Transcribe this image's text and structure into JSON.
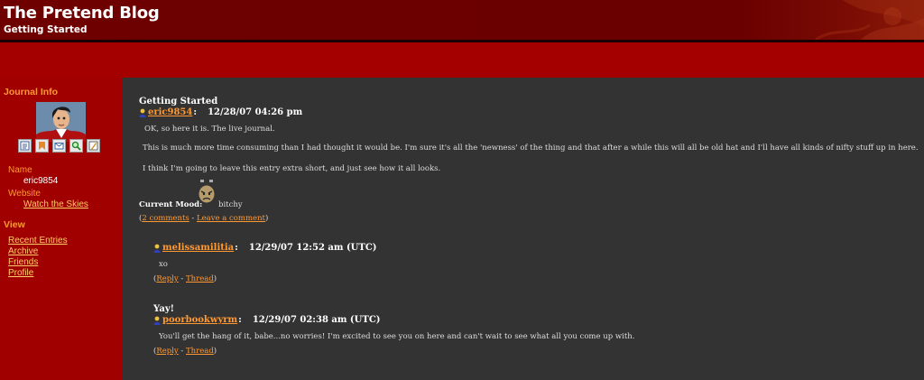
{
  "header": {
    "title": "The Pretend Blog",
    "subtitle": "Getting Started"
  },
  "sidebar": {
    "journal_info_heading": "Journal Info",
    "name_label": "Name",
    "name_value": "eric9854",
    "website_label": "Website",
    "website_link": "Watch the Skies",
    "view_heading": "View",
    "view_links": [
      "Recent Entries",
      "Archive",
      "Friends",
      "Profile"
    ],
    "icons": [
      "memories-icon",
      "tag-icon",
      "mail-icon",
      "search-icon",
      "edit-icon"
    ]
  },
  "entry": {
    "title": "Getting Started",
    "user": "eric9854",
    "date": "12/28/07 04:26 pm",
    "paragraphs": [
      "OK, so here it is. The live journal.",
      "This is much more time consuming than I had thought it would be. I'm sure it's all the 'newness' of the thing and that after a while this will all be old hat and I'll have all kinds of nifty stuff up in here.",
      "I think I'm going to leave this entry extra short, and just see how it all looks."
    ],
    "mood_label": "Current Mood:",
    "mood": "bitchy",
    "comments_link": "2 comments",
    "leave_comment_link": "Leave a comment"
  },
  "comments": [
    {
      "subject": "",
      "user": "melissamilitia",
      "date": "12/29/07 12:52 am (UTC)",
      "text": "xo",
      "reply_label": "Reply",
      "thread_label": "Thread"
    },
    {
      "subject": "Yay!",
      "user": "poorbookwyrm",
      "date": "12/29/07 02:38 am (UTC)",
      "text": "You'll get the hang of it, babe...no worries! I'm excited to see you on here and can't wait to see what all you come up with.",
      "reply_label": "Reply",
      "thread_label": "Thread"
    }
  ],
  "punct": {
    "open_paren": "(",
    "close_paren": ")",
    "dash": " - ",
    "colon": ":"
  },
  "colors": {
    "header_bg": "#6e0000",
    "band_bg": "#a50000",
    "sidebar_bg": "#a00000",
    "main_bg": "#333333",
    "accent_orange": "#ff9933",
    "link_yellow": "#ffcc66"
  }
}
